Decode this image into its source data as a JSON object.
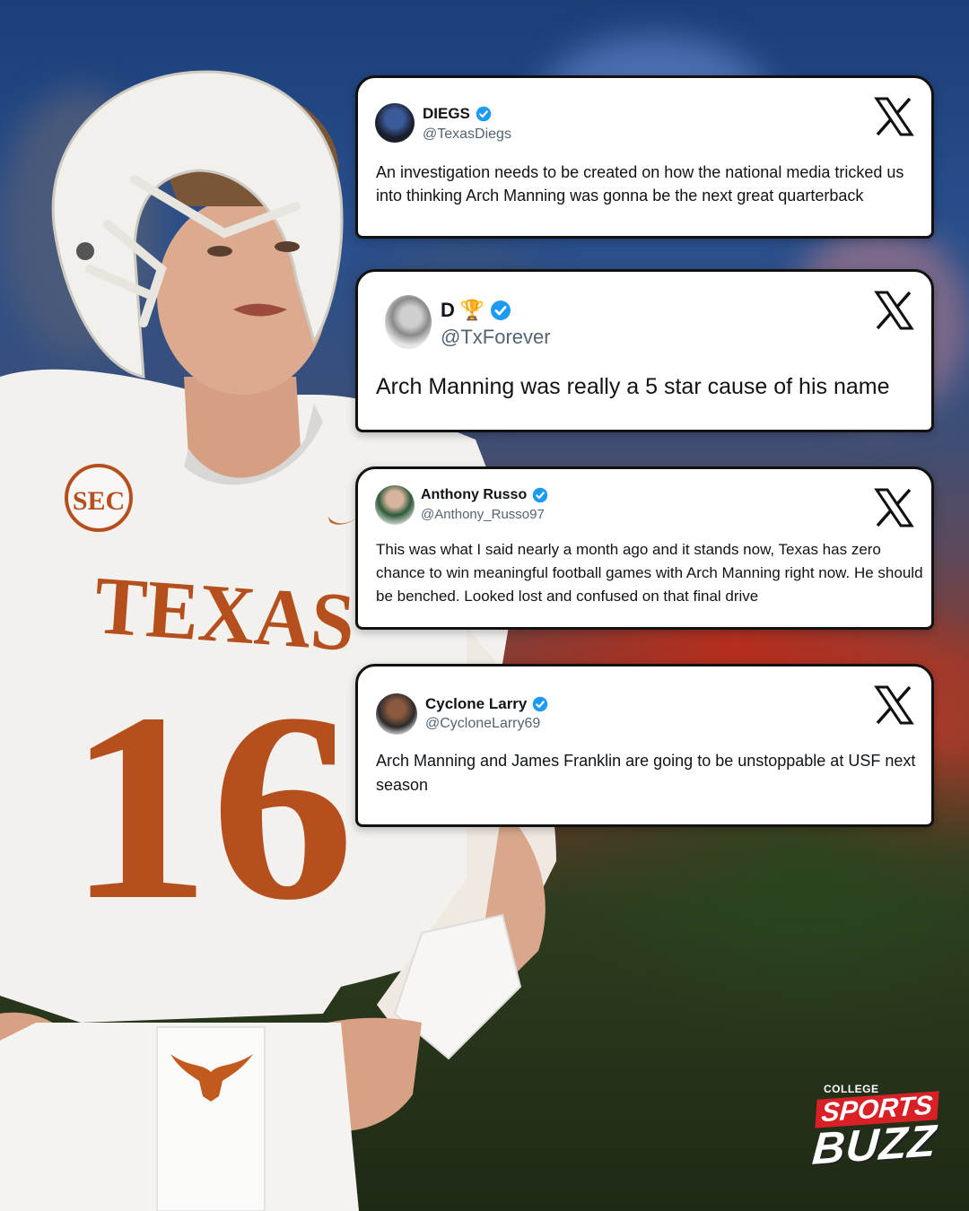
{
  "tweets": [
    {
      "name": "DIEGS",
      "name_suffix": "",
      "handle": "@TexasDiegs",
      "text": "An investigation needs to be created on how the national media tricked us into thinking Arch Manning was gonna be the next great quarterback"
    },
    {
      "name": "D",
      "name_suffix": "🏆",
      "handle": "@TxForever",
      "text": "Arch Manning was really a 5 star cause of his name"
    },
    {
      "name": "Anthony Russo",
      "name_suffix": "",
      "handle": "@Anthony_Russo97",
      "text": "This was what I said nearly a month ago and it stands now, Texas has zero chance to win meaningful football games with Arch Manning right now. He should be benched. Looked lost and confused on that final drive"
    },
    {
      "name": "Cyclone Larry",
      "name_suffix": "",
      "handle": "@CycloneLarry69",
      "text": "Arch Manning and James Franklin are going to be unstoppable at USF next season"
    }
  ],
  "jersey": {
    "conference": "SEC",
    "team": "TEXAS",
    "number": "16"
  },
  "brand": {
    "line1": "COLLEGE",
    "line2": "SPORTS",
    "line3": "BUZZ"
  },
  "colors": {
    "verified": "#1d9bf0",
    "burnt_orange": "#b5501e",
    "brand_red": "#d92027"
  },
  "icons": [
    "x-logo-icon",
    "verified-badge-icon",
    "trophy-icon"
  ]
}
